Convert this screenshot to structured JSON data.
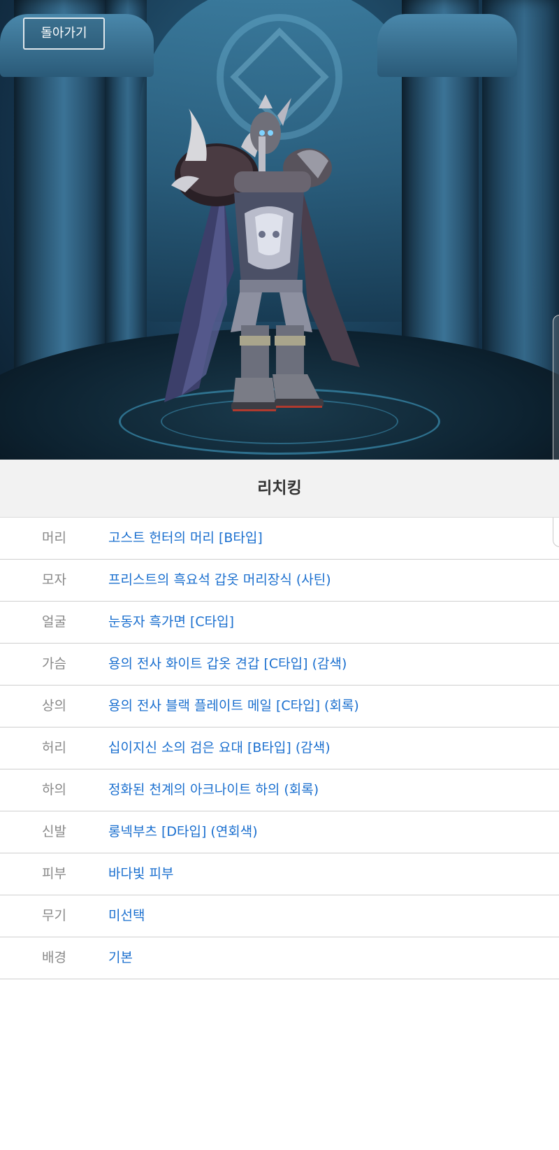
{
  "header": {
    "back_label": "돌아가기"
  },
  "character": {
    "name": "리치킹"
  },
  "equipment": [
    {
      "slot": "머리",
      "item": "고스트 헌터의 머리 [B타입]"
    },
    {
      "slot": "모자",
      "item": "프리스트의 흑요석 갑옷 머리장식 (사틴)"
    },
    {
      "slot": "얼굴",
      "item": "눈동자 흑가면 [C타입]"
    },
    {
      "slot": "가슴",
      "item": "용의 전사 화이트 갑옷 견갑 [C타입] (감색)"
    },
    {
      "slot": "상의",
      "item": "용의 전사 블랙 플레이트 메일 [C타입] (회록)"
    },
    {
      "slot": "허리",
      "item": "십이지신 소의 검은 요대 [B타입] (감색)"
    },
    {
      "slot": "하의",
      "item": "정화된 천계의 아크나이트 하의 (회록)"
    },
    {
      "slot": "신발",
      "item": "롱넥부츠 [D타입] (연회색)"
    },
    {
      "slot": "피부",
      "item": "바다빛 피부"
    },
    {
      "slot": "무기",
      "item": "미선택"
    },
    {
      "slot": "배경",
      "item": "기본"
    }
  ],
  "colors": {
    "link": "#1a6fcf",
    "slot_label": "#888888",
    "title_bg": "#f2f2f2"
  }
}
